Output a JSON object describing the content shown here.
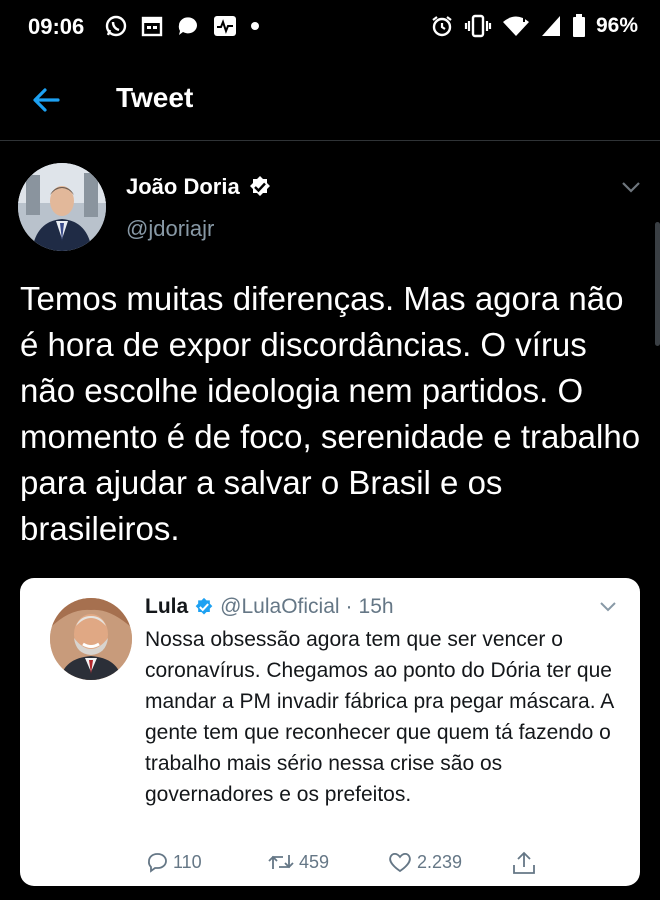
{
  "status_bar": {
    "time": "09:06",
    "battery": "96%",
    "left_icons": [
      "whatsapp-icon",
      "calendar-icon",
      "chat-bubble-icon",
      "activity-icon",
      "dot-icon"
    ],
    "right_icons": [
      "alarm-icon",
      "vibrate-icon",
      "wifi-icon",
      "signal-icon",
      "battery-icon"
    ]
  },
  "header": {
    "title": "Tweet"
  },
  "tweet": {
    "author_name": "João Doria",
    "author_handle": "@jdoriajr",
    "text": "Temos muitas diferenças. Mas agora não é hora de expor discordâncias. O vírus não escolhe ideologia nem partidos. O momento é de foco, serenidade e trabalho para ajudar a salvar o Brasil e os brasileiros."
  },
  "quoted_tweet": {
    "author_name": "Lula",
    "author_handle": "@LulaOficial",
    "separator": "·",
    "time": "15h",
    "text": "Nossa obsessão agora tem que ser vencer o coronavírus. Chegamos ao ponto do Dória ter que mandar a PM invadir fábrica pra pegar máscara. A gente tem que reconhecer que quem tá fazendo o trabalho mais sério nessa crise são os governadores e os prefeitos.",
    "replies": "110",
    "retweets": "459",
    "likes": "2.239"
  },
  "colors": {
    "accent": "#1da1f2",
    "background": "#000000",
    "secondary_text": "#8899a6",
    "card_background": "#ffffff"
  }
}
